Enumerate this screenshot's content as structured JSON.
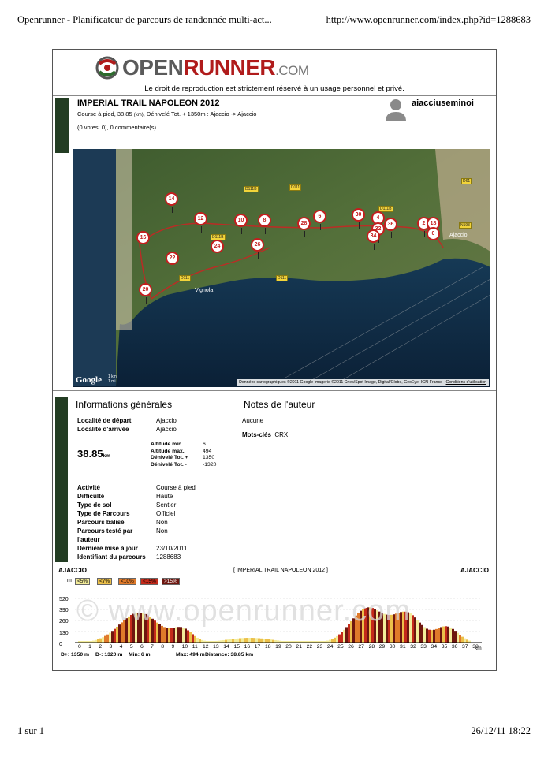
{
  "browser": {
    "title": "Openrunner - Planificateur de parcours de randonnée multi-act...",
    "url": "http://www.openrunner.com/index.php?id=1288683",
    "page": "1 sur 1",
    "datetime": "26/12/11 18:22"
  },
  "logo": {
    "open": "OPEN",
    "runner": "RUNNER",
    "com": ".COM"
  },
  "copyright": "Le droit de reproduction est strictement réservé à un usage personnel et privé.",
  "route": {
    "title": "IMPERIAL TRAIL NAPOLEON 2012",
    "subtitle_a": "Course à pied, 38.85",
    "subtitle_unit": "(km)",
    "subtitle_b": ", Dénivelé Tot. + 1350m : Ajaccio -> Ajaccio",
    "votes": "(0 votes; 0), 0 commentaire(s)"
  },
  "author": {
    "name": "aiacciuseminoi"
  },
  "map": {
    "credits_text": "Données cartographiques ©2011 Google Imagerie ©2011 Cnes/Spot Image, Digital/Globe, GeoEye, IGN-France - ",
    "credits_link": "Conditions d'utilisation",
    "google": "Google",
    "scale_km": "1 km",
    "scale_mi": "1 mi",
    "place_vignola": "Vignola",
    "place_ajaccio": "Ajaccio",
    "markers": [
      "14",
      "12",
      "10",
      "8",
      "6",
      "30",
      "4",
      "36",
      "2",
      "18",
      "0",
      "32",
      "34",
      "28",
      "26",
      "24",
      "22",
      "16",
      "20"
    ],
    "roads": [
      "D111B",
      "D111",
      "D111B",
      "D111",
      "D111",
      "D111B",
      "D61",
      "N193"
    ]
  },
  "info": {
    "title": "Informations générales",
    "depart_label": "Localité de départ",
    "depart_value": "Ajaccio",
    "arrivee_label": "Localité d'arrivée",
    "arrivee_value": "Ajaccio",
    "distance": "38.85",
    "distance_unit": "km",
    "alt_min_label": "Altitude min.",
    "alt_min_value": "6",
    "alt_max_label": "Altitude max.",
    "alt_max_value": "494",
    "den_plus_label": "Dénivelé Tot. +",
    "den_plus_value": "1350",
    "den_minus_label": "Dénivelé Tot. -",
    "den_minus_value": "-1320",
    "activite_label": "Activité",
    "activite_value": "Course à pied",
    "difficulte_label": "Difficulté",
    "difficulte_value": "Haute",
    "sol_label": "Type de sol",
    "sol_value": "Sentier",
    "parcours_label": "Type de Parcours",
    "parcours_value": "Officiel",
    "balise_label": "Parcours balisé",
    "balise_value": "Non",
    "teste_label": "Parcours testé par l'auteur",
    "teste_value": "Non",
    "maj_label": "Dernière mise à jour",
    "maj_value": "23/10/2011",
    "id_label": "Identifiant du parcours",
    "id_value": "1288683"
  },
  "notes": {
    "title": "Notes de l'auteur",
    "text": "Aucune",
    "keywords_label": "Mots-clés",
    "keywords_value": "CRX"
  },
  "profile": {
    "start": "AJACCIO",
    "end": "AJACCIO",
    "title": "[ IMPERIAL TRAIL NAPOLEON 2012 ]",
    "unit_y": "m",
    "unit_x": "km",
    "watermark": "© www.openrunner.com",
    "legend": [
      {
        "label": "<5%",
        "color": "#f3ec9a"
      },
      {
        "label": "<7%",
        "color": "#ecc04a"
      },
      {
        "label": "<10%",
        "color": "#e07a2a"
      },
      {
        "label": "<15%",
        "color": "#c42a1a"
      },
      {
        "label": ">15%",
        "color": "#6e160f"
      }
    ],
    "yticks": [
      "520",
      "390",
      "260",
      "130",
      "0"
    ],
    "xticks": [
      "0",
      "1",
      "2",
      "3",
      "4",
      "5",
      "6",
      "7",
      "8",
      "9",
      "10",
      "11",
      "12",
      "13",
      "14",
      "15",
      "16",
      "17",
      "18",
      "19",
      "20",
      "21",
      "22",
      "23",
      "24",
      "25",
      "26",
      "27",
      "28",
      "29",
      "30",
      "31",
      "32",
      "33",
      "34",
      "35",
      "36",
      "37",
      "38"
    ],
    "footer_dplus": "D+: 1350 m",
    "footer_dminus": "D-: 1320 m",
    "footer_min": "Min: 6 m",
    "footer_max": "Max: 494 m",
    "footer_distance": "Distance: 38.85 km"
  }
}
